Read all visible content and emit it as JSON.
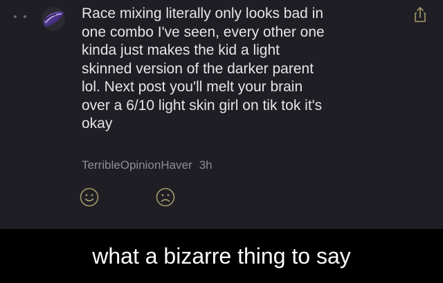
{
  "comment": {
    "text": "Race mixing literally only looks bad in\none combo I've seen, every other one\nkinda just makes the kid a light\nskinned version of the darker parent\nlol. Next post you'll melt your brain\nover a 6/10 light skin girl on tik tok it's\nokay",
    "author": "TerribleOpinionHaver",
    "age": "3h",
    "reactions": [
      "smile-icon",
      "frown-icon"
    ],
    "share_icon": "share-icon"
  },
  "caption": {
    "text": "what a bizarre thing to say"
  },
  "colors": {
    "panel_background": "#1f1e24",
    "text": "#e6e6e8",
    "meta_text": "#8e8d94",
    "icon": "#a59b6a",
    "caption_background": "#000000",
    "caption_text": "#ffffff"
  }
}
